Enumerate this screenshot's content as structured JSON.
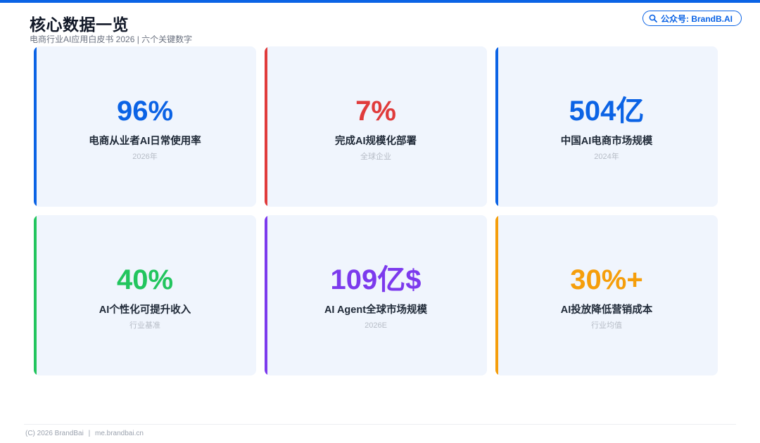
{
  "header": {
    "title": "核心数据一览",
    "subtitle": "电商行业AI应用白皮书 2026 | 六个关键数字",
    "badge": "公众号: BrandB.AI"
  },
  "colors": {
    "brand_blue": "#0b63e5",
    "red": "#e03b3b",
    "green": "#22c55e",
    "purple": "#7c3aed",
    "orange": "#f59e0b",
    "card_bg": "#f0f5fd"
  },
  "cards": [
    {
      "value": "96%",
      "label": "电商从业者AI日常使用率",
      "note": "2026年",
      "color": "#0b63e5"
    },
    {
      "value": "7%",
      "label": "完成AI规模化部署",
      "note": "全球企业",
      "color": "#e03b3b"
    },
    {
      "value": "504亿",
      "label": "中国AI电商市场规模",
      "note": "2024年",
      "color": "#0b63e5"
    },
    {
      "value": "40%",
      "label": "AI个性化可提升收入",
      "note": "行业基准",
      "color": "#22c55e"
    },
    {
      "value": "109亿$",
      "label": "AI Agent全球市场规模",
      "note": "2026E",
      "color": "#7c3aed"
    },
    {
      "value": "30%+",
      "label": "AI投放降低营销成本",
      "note": "行业均值",
      "color": "#f59e0b"
    }
  ],
  "footer": {
    "copyright": "(C) 2026 BrandBai",
    "separator": "|",
    "url": "me.brandbai.cn"
  },
  "icons": {
    "badge_icon": "search-icon"
  }
}
